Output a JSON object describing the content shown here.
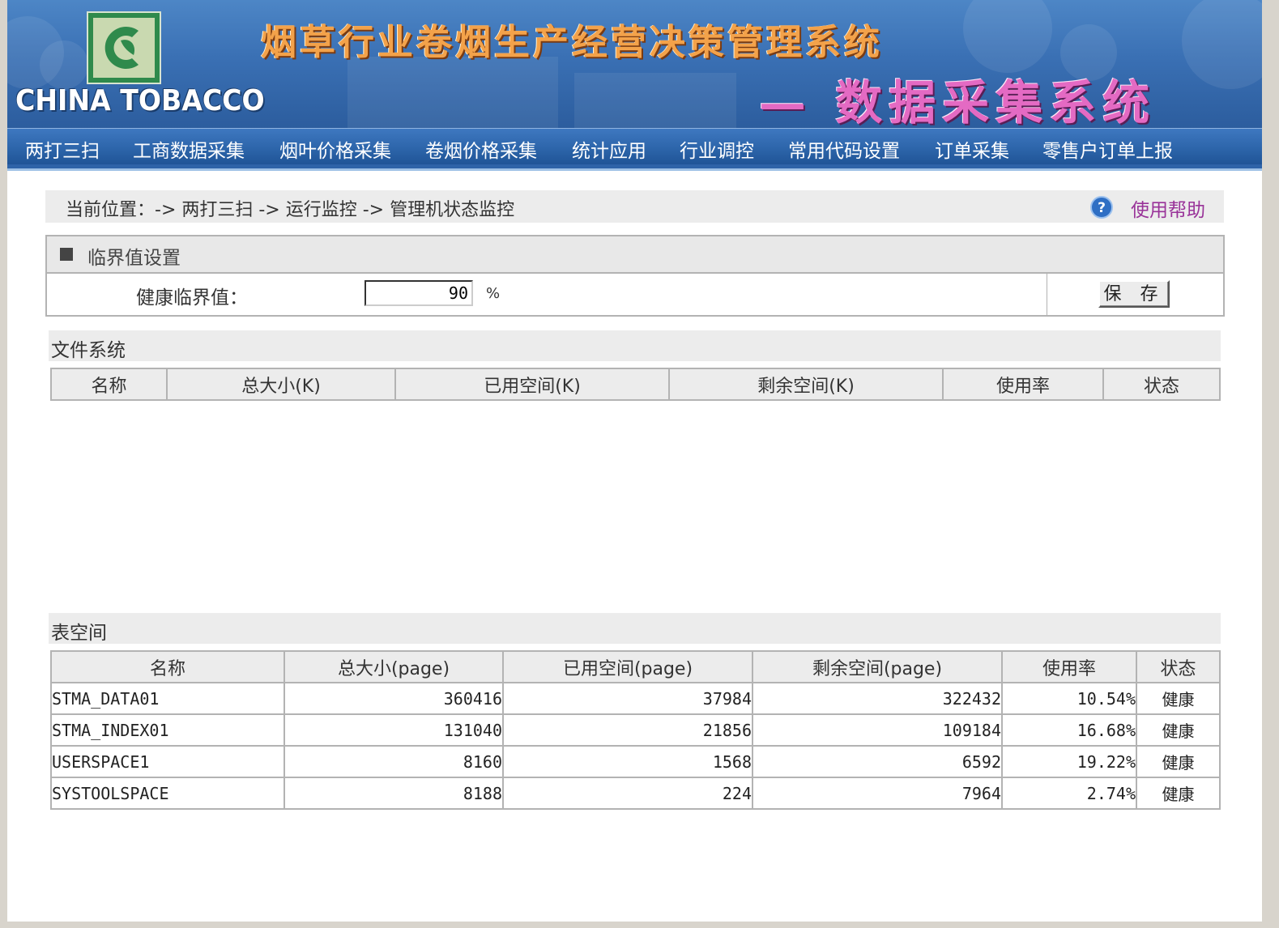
{
  "header": {
    "logo_text": "CHINA TOBACCO",
    "title_main": "烟草行业卷烟生产经营决策管理系统",
    "title_sub": "— 数据采集系统"
  },
  "nav": {
    "items": [
      "两打三扫",
      "工商数据采集",
      "烟叶价格采集",
      "卷烟价格采集",
      "统计应用",
      "行业调控",
      "常用代码设置",
      "订单采集",
      "零售户订单上报"
    ]
  },
  "breadcrumb": {
    "text": "当前位置：-> 两打三扫 -> 运行监控 -> 管理机状态监控",
    "help_label": "使用帮助"
  },
  "threshold": {
    "title": "临界值设置",
    "label": "健康临界值：",
    "value": "90",
    "unit": "%",
    "save_label": "保 存"
  },
  "filesystem": {
    "title": "文件系统",
    "columns": [
      "名称",
      "总大小(K)",
      "已用空间(K)",
      "剩余空间(K)",
      "使用率",
      "状态"
    ],
    "rows": []
  },
  "tablespace": {
    "title": "表空间",
    "columns": [
      "名称",
      "总大小(page)",
      "已用空间(page)",
      "剩余空间(page)",
      "使用率",
      "状态"
    ],
    "rows": [
      {
        "name": "STMA_DATA01",
        "total": "360416",
        "used": "37984",
        "free": "322432",
        "rate": "10.54%",
        "status": "健康"
      },
      {
        "name": "STMA_INDEX01",
        "total": "131040",
        "used": "21856",
        "free": "109184",
        "rate": "16.68%",
        "status": "健康"
      },
      {
        "name": "USERSPACE1",
        "total": "8160",
        "used": "1568",
        "free": "6592",
        "rate": "19.22%",
        "status": "健康"
      },
      {
        "name": "SYSTOOLSPACE",
        "total": "8188",
        "used": "224",
        "free": "7964",
        "rate": "2.74%",
        "status": "健康"
      }
    ]
  }
}
